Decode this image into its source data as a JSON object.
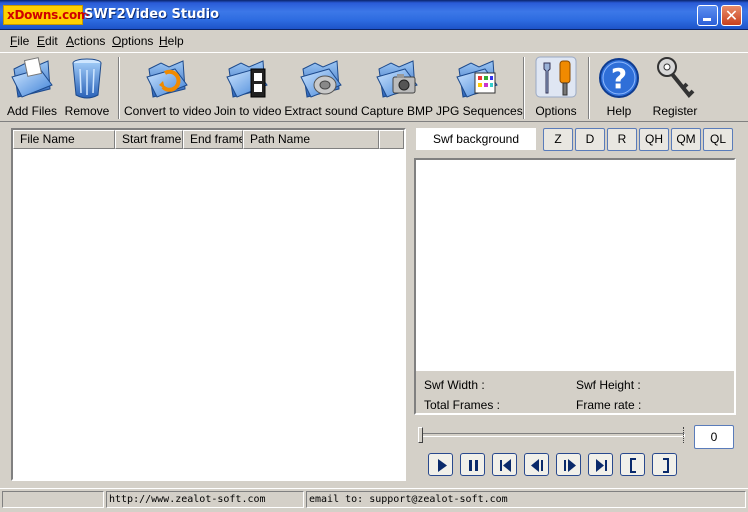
{
  "titlebar": {
    "logo_text": "xDowns.com",
    "title": "SWF2Video Studio"
  },
  "menu": [
    {
      "label": "File",
      "accel": "F",
      "rest": "ile"
    },
    {
      "label": "Edit",
      "accel": "E",
      "rest": "dit"
    },
    {
      "label": "Actions",
      "accel": "A",
      "rest": "ctions"
    },
    {
      "label": "Options",
      "accel": "O",
      "rest": "ptions"
    },
    {
      "label": "Help",
      "accel": "H",
      "rest": "elp"
    }
  ],
  "toolbar": {
    "add_files": "Add Files",
    "remove": "Remove",
    "convert_to_video": "Convert to video",
    "join_to_video": "Join to video",
    "extract_sound": "Extract sound",
    "capture_bmp": "Capture BMP",
    "jpg_sequences": "JPG Sequences",
    "options": "Options",
    "help": "Help",
    "register": "Register"
  },
  "file_list": {
    "columns": [
      "File Name",
      "Start frame",
      "End frame",
      "Path Name"
    ],
    "rows": []
  },
  "preview": {
    "swf_background_label": "Swf background",
    "quality_buttons": [
      "Z",
      "D",
      "R",
      "QH",
      "QM",
      "QL"
    ],
    "swf_width_label": "Swf Width :",
    "swf_height_label": "Swf Height :",
    "total_frames_label": "Total Frames :",
    "frame_rate_label": "Frame rate :"
  },
  "playback": {
    "frame_counter": "0",
    "slider_position": 0,
    "buttons": [
      "play",
      "pause",
      "first-frame",
      "step-back",
      "step-forward",
      "last-frame",
      "mark-in",
      "mark-out"
    ]
  },
  "status": {
    "cell_1": "",
    "url": "http://www.zealot-soft.com",
    "email": "email to: support@zealot-soft.com"
  },
  "colors": {
    "titlebar": "#2d6be0",
    "window_face": "#d4d0c8",
    "button_border": "#5a7cba"
  }
}
